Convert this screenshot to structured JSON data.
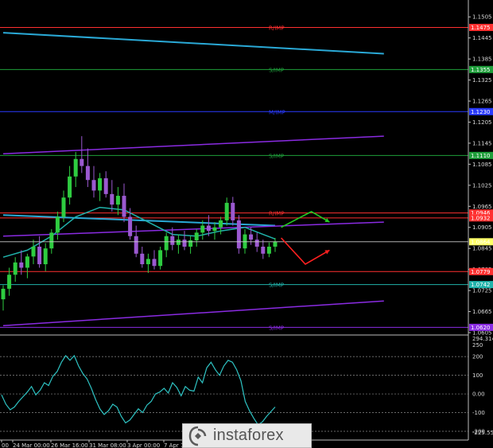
{
  "chart_data": [
    {
      "type": "candlestick",
      "panel": "price",
      "ylim": [
        1.0605,
        1.1535
      ],
      "y_ticks": [
        "1.1505",
        "1.1445",
        "1.1385",
        "1.1325",
        "1.1265",
        "1.1205",
        "1.1145",
        "1.1085",
        "1.1025",
        "1.0965",
        "1.0905",
        "1.0845",
        "1.0785",
        "1.0725",
        "1.0665",
        "1.0605"
      ],
      "x_labels": [
        "00",
        "24 Mar 00:00",
        "26 Mar 16:00",
        "31 Mar 08:00",
        "3 Apr 00:00",
        "7 Apr 16:00"
      ],
      "candles": [
        {
          "o": 1.07,
          "h": 1.074,
          "l": 1.0668,
          "c": 1.073
        },
        {
          "o": 1.073,
          "h": 1.079,
          "l": 1.071,
          "c": 1.077
        },
        {
          "o": 1.077,
          "h": 1.082,
          "l": 1.075,
          "c": 1.0805
        },
        {
          "o": 1.0805,
          "h": 1.084,
          "l": 1.077,
          "c": 1.079
        },
        {
          "o": 1.079,
          "h": 1.083,
          "l": 1.076,
          "c": 1.0822
        },
        {
          "o": 1.0822,
          "h": 1.087,
          "l": 1.08,
          "c": 1.085
        },
        {
          "o": 1.085,
          "h": 1.088,
          "l": 1.079,
          "c": 1.08
        },
        {
          "o": 1.08,
          "h": 1.086,
          "l": 1.078,
          "c": 1.0845
        },
        {
          "o": 1.0845,
          "h": 1.09,
          "l": 1.083,
          "c": 1.089
        },
        {
          "o": 1.089,
          "h": 1.095,
          "l": 1.087,
          "c": 1.0935
        },
        {
          "o": 1.0935,
          "h": 1.101,
          "l": 1.092,
          "c": 1.099
        },
        {
          "o": 1.099,
          "h": 1.108,
          "l": 1.097,
          "c": 1.105
        },
        {
          "o": 1.105,
          "h": 1.112,
          "l": 1.102,
          "c": 1.11
        },
        {
          "o": 1.11,
          "h": 1.1165,
          "l": 1.106,
          "c": 1.108
        },
        {
          "o": 1.108,
          "h": 1.113,
          "l": 1.102,
          "c": 1.104
        },
        {
          "o": 1.104,
          "h": 1.108,
          "l": 1.099,
          "c": 1.101
        },
        {
          "o": 1.101,
          "h": 1.106,
          "l": 1.098,
          "c": 1.1045
        },
        {
          "o": 1.1045,
          "h": 1.1065,
          "l": 1.099,
          "c": 1.1
        },
        {
          "o": 1.1,
          "h": 1.104,
          "l": 1.095,
          "c": 1.097
        },
        {
          "o": 1.097,
          "h": 1.102,
          "l": 1.094,
          "c": 1.0995
        },
        {
          "o": 1.0995,
          "h": 1.103,
          "l": 1.092,
          "c": 1.0935
        },
        {
          "o": 1.0935,
          "h": 1.096,
          "l": 1.087,
          "c": 1.088
        },
        {
          "o": 1.088,
          "h": 1.091,
          "l": 1.082,
          "c": 1.083
        },
        {
          "o": 1.083,
          "h": 1.085,
          "l": 1.079,
          "c": 1.08
        },
        {
          "o": 1.08,
          "h": 1.083,
          "l": 1.0775,
          "c": 1.0815
        },
        {
          "o": 1.0815,
          "h": 1.084,
          "l": 1.0785,
          "c": 1.0795
        },
        {
          "o": 1.0795,
          "h": 1.085,
          "l": 1.0785,
          "c": 1.084
        },
        {
          "o": 1.084,
          "h": 1.089,
          "l": 1.082,
          "c": 1.088
        },
        {
          "o": 1.088,
          "h": 1.0905,
          "l": 1.084,
          "c": 1.0855
        },
        {
          "o": 1.0855,
          "h": 1.0885,
          "l": 1.083,
          "c": 1.087
        },
        {
          "o": 1.087,
          "h": 1.0895,
          "l": 1.084,
          "c": 1.085
        },
        {
          "o": 1.085,
          "h": 1.088,
          "l": 1.083,
          "c": 1.0868
        },
        {
          "o": 1.0868,
          "h": 1.09,
          "l": 1.085,
          "c": 1.089
        },
        {
          "o": 1.089,
          "h": 1.0925,
          "l": 1.087,
          "c": 1.091
        },
        {
          "o": 1.091,
          "h": 1.094,
          "l": 1.088,
          "c": 1.0895
        },
        {
          "o": 1.0895,
          "h": 1.092,
          "l": 1.087,
          "c": 1.0905
        },
        {
          "o": 1.0905,
          "h": 1.0935,
          "l": 1.0885,
          "c": 1.0925
        },
        {
          "o": 1.0925,
          "h": 1.099,
          "l": 1.091,
          "c": 1.0975
        },
        {
          "o": 1.0975,
          "h": 1.0992,
          "l": 1.091,
          "c": 1.0925
        },
        {
          "o": 1.0925,
          "h": 1.094,
          "l": 1.083,
          "c": 1.0845
        },
        {
          "o": 1.0845,
          "h": 1.09,
          "l": 1.083,
          "c": 1.0885
        },
        {
          "o": 1.0885,
          "h": 1.0905,
          "l": 1.0855,
          "c": 1.087
        },
        {
          "o": 1.087,
          "h": 1.089,
          "l": 1.0835,
          "c": 1.085
        },
        {
          "o": 1.085,
          "h": 1.087,
          "l": 1.0815,
          "c": 1.083
        },
        {
          "o": 1.083,
          "h": 1.0862,
          "l": 1.082,
          "c": 1.085
        },
        {
          "o": 1.085,
          "h": 1.0875,
          "l": 1.0835,
          "c": 1.0864
        }
      ],
      "lines": [
        {
          "name": "",
          "color": "#2aa9d6",
          "points": [
            [
              0,
              1.094
            ],
            [
              45,
              1.091
            ]
          ]
        },
        {
          "name": "",
          "color": "#2aa9d6",
          "points": [
            [
              0,
              1.146
            ],
            [
              63,
              1.14
            ]
          ]
        },
        {
          "name": "",
          "color": "#8a2be2",
          "points": [
            [
              0,
              1.1115
            ],
            [
              63,
              1.1165
            ]
          ]
        },
        {
          "name": "",
          "color": "#8a2be2",
          "points": [
            [
              0,
              1.088
            ],
            [
              63,
              1.092
            ]
          ]
        },
        {
          "name": "",
          "color": "#8a2be2",
          "points": [
            [
              0,
              1.0625
            ],
            [
              63,
              1.0695
            ]
          ]
        },
        {
          "name": "",
          "color": "#20b2aa",
          "points": [
            [
              0,
              1.082
            ],
            [
              4,
              1.084
            ],
            [
              8,
              1.088
            ],
            [
              12,
              1.0935
            ],
            [
              16,
              1.0962
            ],
            [
              20,
              1.0955
            ],
            [
              24,
              1.092
            ],
            [
              28,
              1.0885
            ],
            [
              32,
              1.088
            ],
            [
              36,
              1.0895
            ],
            [
              40,
              1.0905
            ],
            [
              43,
              1.0885
            ],
            [
              45,
              1.0872
            ]
          ]
        }
      ],
      "levels": [
        {
          "value": 1.1475,
          "color": "#ff3030",
          "tag": "R/IMP",
          "box": "1.1475"
        },
        {
          "value": 1.1355,
          "color": "#1e9e3a",
          "tag": "S/IMP",
          "box": "1.1355"
        },
        {
          "value": 1.1235,
          "color": "#2a3bff",
          "tag": "M/IMP",
          "box": "1.1230"
        },
        {
          "value": 1.111,
          "color": "#1e9e3a",
          "tag": "S/IMP",
          "box": "1.1110"
        },
        {
          "value": 1.0946,
          "color": "#ff3030",
          "tag": "R/IMP",
          "box": "1.0946"
        },
        {
          "value": 1.0932,
          "color": "#ff3030",
          "tag": "",
          "box": "1.0932"
        },
        {
          "value": 1.0779,
          "color": "#ff3030",
          "tag": "",
          "box": "1.0779"
        },
        {
          "value": 1.0742,
          "color": "#20b2aa",
          "tag": "S/IMP",
          "box": "1.0742"
        },
        {
          "value": 1.062,
          "color": "#8a2be2",
          "tag": "S/IMP",
          "box": "1.0620"
        }
      ],
      "current_price": {
        "value": 1.0864,
        "box": "1.0864",
        "color": "#ffff66"
      },
      "arrows": [
        {
          "color": "#22cc22",
          "points": [
            [
              46,
              1.0905
            ],
            [
              51,
              1.095
            ],
            [
              54,
              1.092
            ]
          ]
        },
        {
          "color": "#ff2020",
          "points": [
            [
              46,
              1.0875
            ],
            [
              50,
              1.08
            ],
            [
              54,
              1.084
            ]
          ]
        }
      ]
    },
    {
      "type": "line",
      "panel": "oscillator",
      "ylim": [
        -225.5555,
        294.3141
      ],
      "top_labels": [
        "294.3141",
        "250"
      ],
      "y_ticks": [
        "200",
        "100",
        "0.00",
        "-100",
        "-200"
      ],
      "bottom_label": "-225.5555",
      "levels": [
        200,
        100,
        0,
        -100,
        -200
      ],
      "series": [
        {
          "name": "",
          "color": "#2ec3c3",
          "x_start": 0,
          "values": [
            -5,
            -55,
            -85,
            -70,
            -40,
            -15,
            10,
            40,
            -5,
            20,
            60,
            45,
            95,
            120,
            170,
            205,
            180,
            205,
            150,
            110,
            80,
            30,
            -30,
            -80,
            -110,
            -90,
            -55,
            -70,
            -120,
            -155,
            -140,
            -110,
            -80,
            -100,
            -60,
            -40,
            0,
            10,
            30,
            5,
            60,
            35,
            -10,
            40,
            20,
            15,
            90,
            60,
            140,
            170,
            130,
            100,
            150,
            180,
            170,
            130,
            70,
            -40,
            -90,
            -130,
            -165,
            -150,
            -120,
            -95,
            -70
          ]
        }
      ]
    }
  ],
  "watermark": {
    "text": "instaforex"
  }
}
